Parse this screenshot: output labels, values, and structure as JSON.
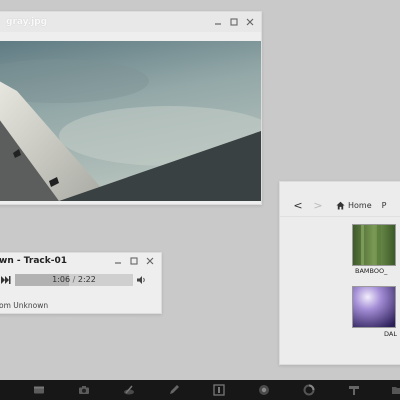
{
  "viewer": {
    "title": "gray.jpg"
  },
  "player": {
    "title": "wn - Track-01",
    "time_current": "1:06",
    "time_total": "2:22",
    "progress": 0.46,
    "artist": "om Unknown"
  },
  "file_browser": {
    "back_label": "<",
    "forward_label": ">",
    "home_label": "Home",
    "next_crumb": "P",
    "items": [
      {
        "label": "BAMBOO_"
      },
      {
        "label": "DAL"
      }
    ]
  },
  "dock": {
    "items": [
      {
        "icon": "terminal-icon"
      },
      {
        "icon": "camera-icon"
      },
      {
        "icon": "paint-icon"
      },
      {
        "icon": "pencil-icon"
      },
      {
        "icon": "media-icon"
      },
      {
        "icon": "browser-icon"
      },
      {
        "icon": "settings-icon"
      },
      {
        "icon": "store-icon"
      },
      {
        "icon": "folder-icon"
      }
    ]
  },
  "colors": {
    "desktop": "#c9c9c9",
    "dock": "#171717",
    "window": "#f0f0f0"
  }
}
